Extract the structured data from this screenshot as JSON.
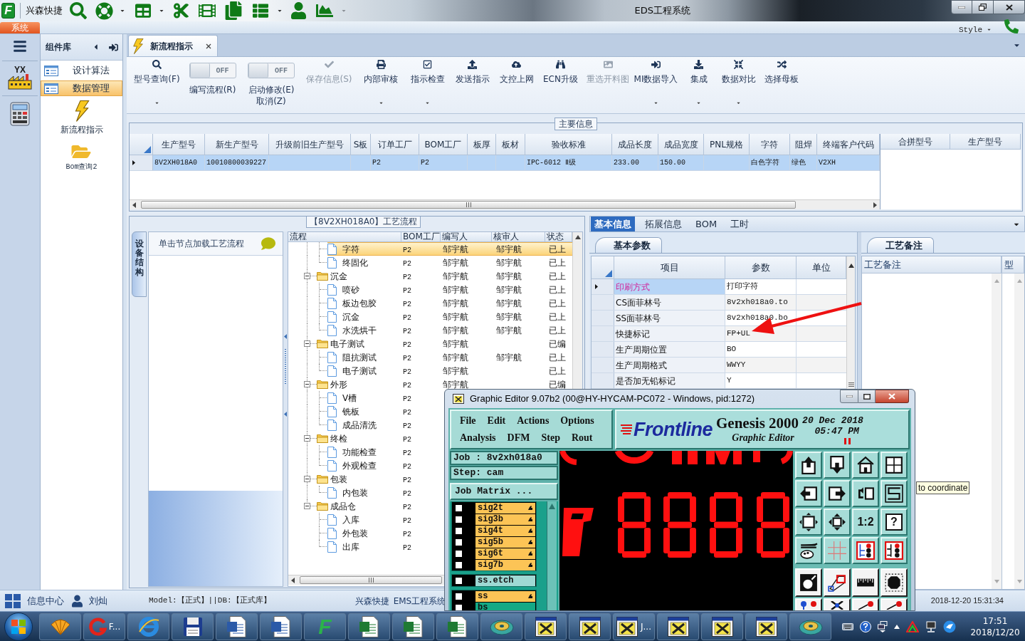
{
  "window": {
    "logo": "F",
    "app_name": "兴森快捷",
    "title": "EDS工程系统"
  },
  "ribbon": {
    "tab": "系统",
    "style_menu": "Style"
  },
  "rail": {
    "logo": "YX"
  },
  "sidebar": {
    "title": "组件库",
    "groups": [
      {
        "label": "设计算法",
        "selected": false
      },
      {
        "label": "数据管理",
        "selected": true
      }
    ],
    "items": [
      {
        "label": "新流程指示"
      },
      {
        "label": "Bom查询2"
      }
    ]
  },
  "document_tab": {
    "label": "新流程指示"
  },
  "toolbar": [
    {
      "kind": "button",
      "label": "型号查询(F)",
      "dropdown": true,
      "disabled": false
    },
    {
      "kind": "toggle",
      "label": "编写流程(R)",
      "switch_text": "OFF",
      "on": false
    },
    {
      "kind": "toggle",
      "label": "启动修改(E)",
      "label_2": "取消(Z)",
      "switch_text": "OFF",
      "on": false
    },
    {
      "kind": "button",
      "label": "保存信息(S)",
      "dropdown": false,
      "disabled": true
    },
    {
      "kind": "button",
      "label": "内部审核",
      "dropdown": true,
      "disabled": false
    },
    {
      "kind": "button",
      "label": "指示检查",
      "dropdown": true,
      "disabled": false
    },
    {
      "kind": "button",
      "label": "发送指示",
      "dropdown": false,
      "disabled": false
    },
    {
      "kind": "button",
      "label": "文控上网",
      "dropdown": false,
      "disabled": false
    },
    {
      "kind": "button",
      "label": "ECN升级",
      "dropdown": false,
      "disabled": false
    },
    {
      "kind": "button",
      "label": "重选开料图",
      "dropdown": false,
      "disabled": true
    },
    {
      "kind": "button",
      "label": "MI数据导入",
      "dropdown": true,
      "disabled": false
    },
    {
      "kind": "button",
      "label": "集成",
      "dropdown": true,
      "disabled": false
    },
    {
      "kind": "button",
      "label": "数据对比",
      "dropdown": true,
      "disabled": false
    },
    {
      "kind": "button",
      "label": "选择母板",
      "dropdown": false,
      "disabled": false
    }
  ],
  "main_info": {
    "title": "主要信息",
    "columns": [
      "生产型号",
      "新生产型号",
      "升级前旧生产型号",
      "S板",
      "订单工厂",
      "BOM工厂",
      "板厚",
      "板材",
      "验收标准",
      "成品长度",
      "成品宽度",
      "PNL规格",
      "字符",
      "阻焊",
      "终端客户代码"
    ],
    "rows": [
      {
        "selected": true,
        "cells": [
          "8V2XH018A0",
          "10010800039227",
          null,
          null,
          "P2",
          "P2",
          null,
          null,
          "IPC-6012 Ⅱ级",
          "233.00",
          "150.00",
          null,
          "白色字符",
          "绿色",
          "V2XH"
        ]
      }
    ],
    "side_columns": [
      "合拼型号",
      "生产型号"
    ]
  },
  "process_flow": {
    "title": "【8V2XH018A0】工艺流程",
    "side_tab": "设备结构",
    "hint": "单击节点加载工艺流程",
    "columns": [
      "流程",
      "BOM工厂",
      "编写人",
      "核审人",
      "状态"
    ],
    "tree": [
      {
        "children": [
          {
            "kind": "step",
            "label": "字符",
            "selected": true,
            "factory": "P2",
            "editor": "邹宇航",
            "reviewer": "邹宇航",
            "status": "已上"
          },
          {
            "kind": "step",
            "label": "终固化",
            "selected": false,
            "factory": "P2",
            "editor": "邹宇航",
            "reviewer": "邹宇航",
            "status": "已上"
          }
        ]
      },
      {
        "kind": "folder",
        "label": "沉金",
        "expanded": true,
        "selected": false,
        "factory": "P2",
        "editor": "邹宇航",
        "reviewer": "邹宇航",
        "status": "已上",
        "children": [
          {
            "kind": "step",
            "label": "喷砂",
            "selected": false,
            "factory": "P2",
            "editor": "邹宇航",
            "reviewer": "邹宇航",
            "status": "已上"
          },
          {
            "kind": "step",
            "label": "板边包胶",
            "selected": false,
            "factory": "P2",
            "editor": "邹宇航",
            "reviewer": "邹宇航",
            "status": "已上"
          },
          {
            "kind": "step",
            "label": "沉金",
            "selected": false,
            "factory": "P2",
            "editor": "邹宇航",
            "reviewer": "邹宇航",
            "status": "已上"
          },
          {
            "kind": "step",
            "label": "水洗烘干",
            "selected": false,
            "factory": "P2",
            "editor": "邹宇航",
            "reviewer": "邹宇航",
            "status": "已上"
          }
        ]
      },
      {
        "kind": "folder",
        "label": "电子测试",
        "expanded": true,
        "selected": false,
        "factory": "P2",
        "editor": "邹宇航",
        "status": "已编",
        "children": [
          {
            "kind": "step",
            "label": "阻抗测试",
            "selected": false,
            "factory": "P2",
            "editor": "邹宇航",
            "reviewer": "邹宇航",
            "status": "已上"
          },
          {
            "kind": "step",
            "label": "电子测试",
            "selected": false,
            "factory": "P2",
            "editor": "邹宇航",
            "status": "已上"
          }
        ]
      },
      {
        "kind": "folder",
        "label": "外形",
        "expanded": true,
        "selected": false,
        "factory": "P2",
        "editor": "邹宇航",
        "status": "已编",
        "children": [
          {
            "kind": "step",
            "label": "V槽",
            "selected": false,
            "factory": "P2"
          },
          {
            "kind": "step",
            "label": "铣板",
            "selected": false,
            "factory": "P2"
          },
          {
            "kind": "step",
            "label": "成品清洗",
            "selected": false,
            "factory": "P2"
          }
        ]
      },
      {
        "kind": "folder",
        "label": "终检",
        "expanded": true,
        "selected": false,
        "factory": "P2",
        "children": [
          {
            "kind": "step",
            "label": "功能检查",
            "selected": false,
            "factory": "P2"
          },
          {
            "kind": "step",
            "label": "外观检查",
            "selected": false,
            "factory": "P2"
          }
        ]
      },
      {
        "kind": "folder",
        "label": "包装",
        "expanded": true,
        "selected": false,
        "factory": "P2",
        "children": [
          {
            "kind": "step",
            "label": "内包装",
            "selected": false,
            "factory": "P2"
          }
        ]
      },
      {
        "kind": "folder",
        "label": "成品仓",
        "expanded": true,
        "selected": false,
        "factory": "P2",
        "children": [
          {
            "kind": "step",
            "label": "入库",
            "selected": false,
            "factory": "P2"
          },
          {
            "kind": "step",
            "label": "外包装",
            "selected": false,
            "factory": "P2"
          },
          {
            "kind": "step",
            "label": "出库",
            "selected": false,
            "factory": "P2"
          }
        ]
      }
    ]
  },
  "detail_tabs": [
    {
      "label": "基本信息",
      "selected": true
    },
    {
      "label": "拓展信息",
      "selected": false
    },
    {
      "label": "BOM",
      "selected": false
    },
    {
      "label": "工时",
      "selected": false
    }
  ],
  "basic_params": {
    "tab": "基本参数",
    "columns": [
      "项目",
      "参数",
      "单位"
    ],
    "rows": [
      {
        "item": "印刷方式",
        "value": "打印字符",
        "selected": true
      },
      {
        "item": "CS面菲林号",
        "value": "8v2xh018a0.to",
        "selected": false
      },
      {
        "item": "SS面菲林号",
        "value": "8v2xh018a0.bo",
        "selected": false
      },
      {
        "item": "快捷标记",
        "value": "FP+UL",
        "selected": false
      },
      {
        "item": "生产周期位置",
        "value": "BO",
        "selected": false
      },
      {
        "item": "生产周期格式",
        "value": "WWYY",
        "selected": false
      },
      {
        "item": "是否加无铅标记",
        "value": "Y",
        "selected": false
      }
    ]
  },
  "remarks": {
    "tab": "工艺备注",
    "columns": [
      "工艺备注",
      "型"
    ]
  },
  "tooltip": "to coordinate",
  "status_bar": {
    "info_center": "信息中心",
    "user": "刘灿",
    "environment": "Model:【正式】||DB:【正式库】",
    "company": "兴森快捷",
    "system": "EMS工程系统",
    "timestamp": "2018-12-20 15:31:34"
  },
  "graphic_editor": {
    "title": "Graphic Editor 9.07b2 (00@HY-HYCAM-PC072 - Windows, pid:1272)",
    "menu_rows": [
      [
        "File",
        "Edit",
        "Actions",
        "Options"
      ],
      [
        "Analysis",
        "DFM",
        "Step",
        "Rout"
      ]
    ],
    "brand": "Frontline",
    "product": "Genesis 2000",
    "subtitle": "Graphic Editor",
    "date": "20 Dec 2018",
    "time": "05:47 PM",
    "job": "Job : 8v2xh018a0",
    "step": "Step: cam",
    "matrix_button": "Job Matrix ...",
    "zoom_button": "1:2",
    "help_button": "?",
    "layer_groups": [
      {
        "layers": [
          {
            "name": "sig2t",
            "color": "#fcc456",
            "checked": false,
            "affected": true
          },
          {
            "name": "sig3b",
            "color": "#fcc456",
            "checked": false,
            "affected": true
          },
          {
            "name": "sig4t",
            "color": "#fcc456",
            "checked": false,
            "affected": true
          },
          {
            "name": "sig5b",
            "color": "#fcc456",
            "checked": false,
            "affected": true
          },
          {
            "name": "sig6t",
            "color": "#fcc456",
            "checked": false,
            "affected": true
          },
          {
            "name": "sig7b",
            "color": "#fcc456",
            "checked": false,
            "affected": true
          }
        ]
      },
      {
        "layers": [
          {
            "name": "ss.etch",
            "color": "#9fd9d4",
            "checked": false,
            "affected": false
          }
        ]
      },
      {
        "layers": [
          {
            "name": "ss",
            "color": "#fcc456",
            "checked": false,
            "affected": true
          },
          {
            "name": "bs",
            "color": "#14a985",
            "checked": false,
            "affected": false
          }
        ]
      }
    ]
  },
  "taskbar": {
    "app_label": "F...",
    "logo": "F",
    "window_label": "J...",
    "time": "17:51",
    "date": "2018/12/20"
  }
}
